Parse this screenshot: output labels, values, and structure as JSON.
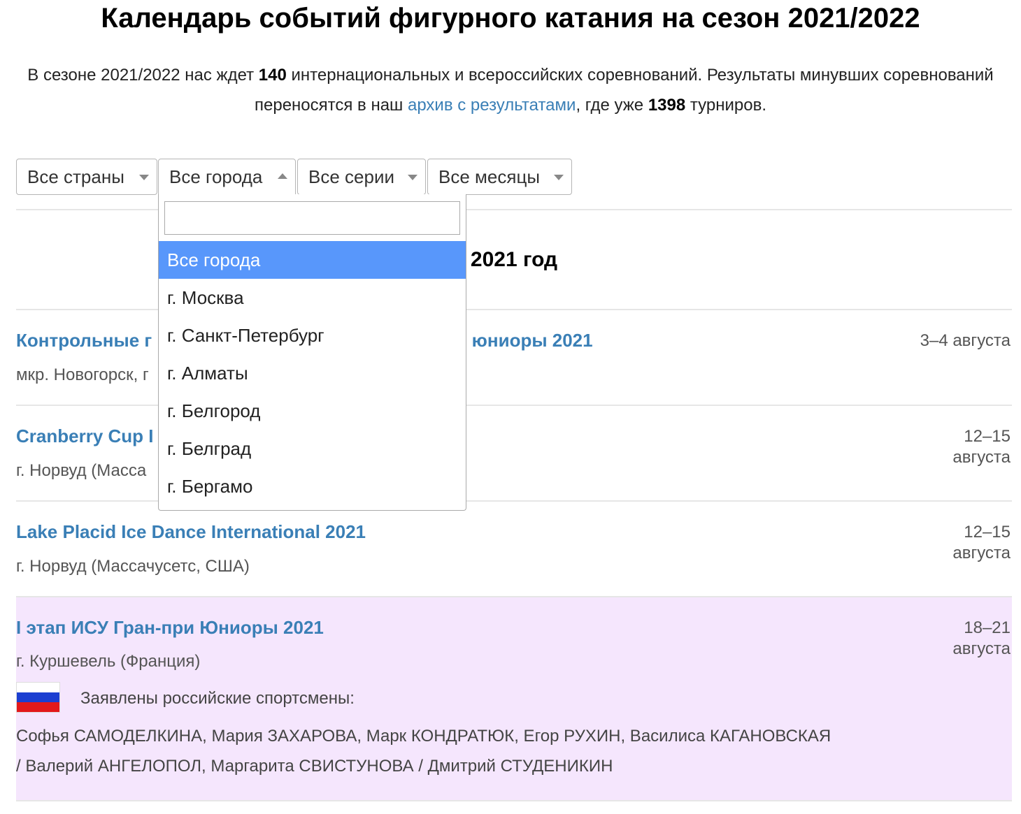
{
  "page": {
    "title": "Календарь событий фигурного катания на сезон 2021/2022",
    "intro": {
      "part1": "В сезоне 2021/2022 нас ждет ",
      "count": "140",
      "part2": " интернациональных и всероссийских соревнований. Результаты минувших соревнований переносятся в наш ",
      "archive_link": "архив с результатами",
      "part3": ", где уже ",
      "archive_count": "1398",
      "part4": " турниров."
    }
  },
  "filters": {
    "countries": "Все страны",
    "cities": "Все города",
    "series": "Все серии",
    "months": "Все месяцы"
  },
  "city_dropdown": {
    "search_value": "",
    "options": [
      "Все города",
      "г. Москва",
      "г. Санкт-Петербург",
      "г. Алматы",
      "г. Белгород",
      "г. Белград",
      "г. Бергамо"
    ],
    "selected": "Все города"
  },
  "year_heading": "2021 год",
  "events": [
    {
      "title_left": "Контрольные г",
      "title_right": ", юниоры 2021",
      "place": "мкр. Новогорск, г",
      "date": "3–4 августа"
    },
    {
      "title": "Cranberry Cup I",
      "place": "г. Норвуд (Масса",
      "date_line1": "12–15",
      "date_line2": "августа"
    },
    {
      "title": "Lake Placid Ice Dance International 2021",
      "place": "г. Норвуд (Массачусетс, США)",
      "date_line1": "12–15",
      "date_line2": "августа"
    },
    {
      "title": "I этап ИСУ Гран-при Юниоры 2021",
      "place": "г. Куршевель (Франция)",
      "date_line1": "18–21",
      "date_line2": "августа",
      "highlight_color": "#f5e6fd",
      "flag_icon": "russia-flag-icon",
      "declared_label": "Заявлены российские спортсмены:",
      "athletes_line1": "Софья САМОДЕЛКИНА, Мария ЗАХАРОВА, Марк КОНДРАТЮК, Егор РУХИН, Василиса КАГАНОВСКАЯ",
      "athletes_line2": "/ Валерий АНГЕЛОПОЛ, Маргарита СВИСТУНОВА / Дмитрий СТУДЕНИКИН"
    }
  ],
  "colors": {
    "link": "#3a7fb6",
    "highlight": "#f5e6fd",
    "dropdown_active": "#5897fb"
  }
}
